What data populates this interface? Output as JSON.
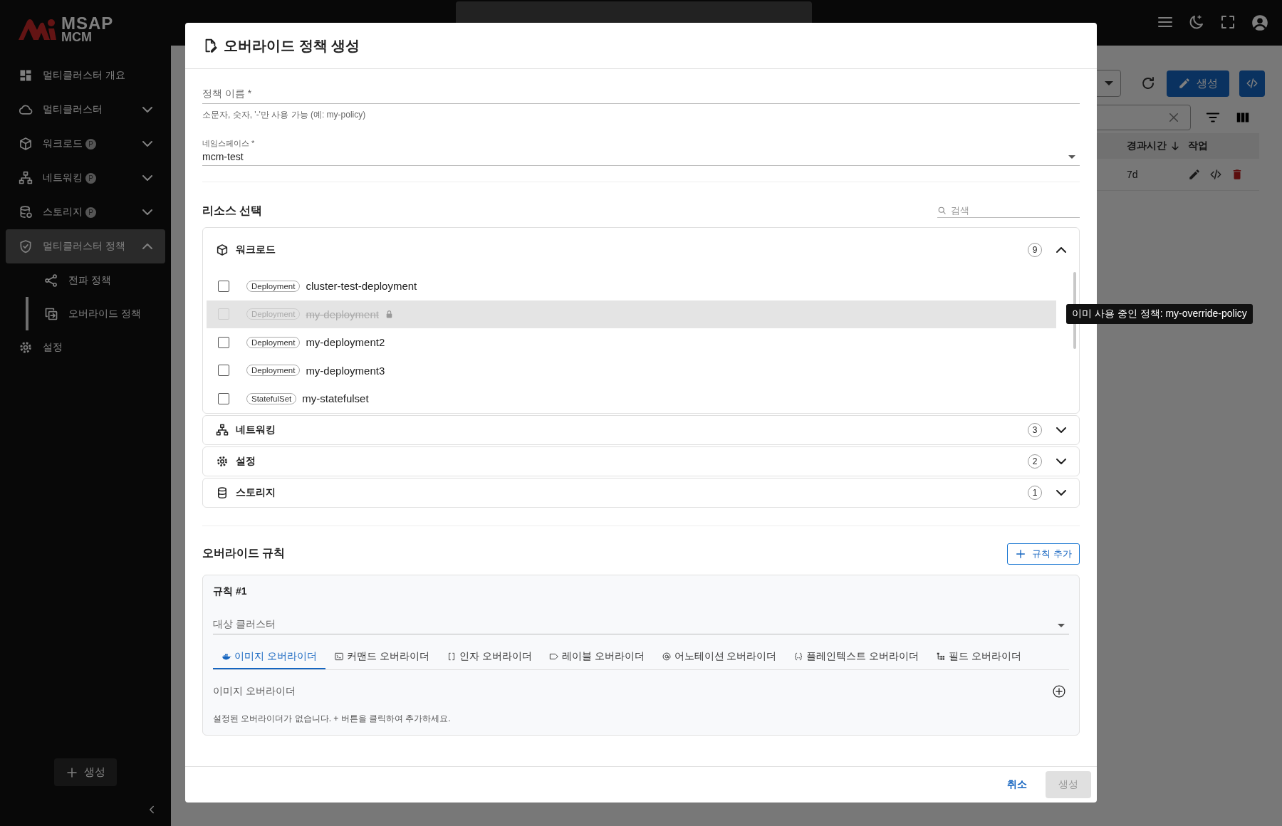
{
  "app": {
    "logo_top": "MSAP",
    "logo_bottom": "MCM"
  },
  "sidebar": {
    "items": [
      {
        "label": "멀티클러스터 개요",
        "selected": false
      },
      {
        "label": "멀티클러스터",
        "selected": false,
        "expanded": false
      },
      {
        "label": "워크로드",
        "badge": "P",
        "selected": false,
        "expanded": false
      },
      {
        "label": "네트워킹",
        "badge": "P",
        "selected": false,
        "expanded": false
      },
      {
        "label": "스토리지",
        "badge": "P",
        "selected": false,
        "expanded": false
      },
      {
        "label": "멀티클러스터 정책",
        "selected": true,
        "expanded": true,
        "children": [
          {
            "label": "전파 정책",
            "selected": false
          },
          {
            "label": "오버라이드 정책",
            "selected": true
          }
        ]
      },
      {
        "label": "설정",
        "selected": false
      }
    ],
    "create_button": "생성"
  },
  "page": {
    "create_button": "생성",
    "table": {
      "columns": [
        {
          "label": "경과시간",
          "sorted": true
        },
        {
          "label": "작업"
        }
      ],
      "rows": [
        {
          "age": "7d"
        }
      ]
    }
  },
  "dialog": {
    "title": "오버라이드 정책 생성",
    "fields": [
      {
        "label": "정책 이름 *",
        "helper": "소문자, 숫자, '-'만 사용 가능 (예: my-policy)"
      },
      {
        "label": "네임스페이스 *",
        "value": "mcm-test",
        "kind": "select"
      }
    ],
    "resources": {
      "title": "리소스 선택",
      "search_placeholder": "검색",
      "groups": [
        {
          "name": "워크로드",
          "count": "9",
          "expanded": true,
          "items": [
            {
              "type": "Deployment",
              "name": "cluster-test-deployment",
              "checked": false,
              "disabled": false,
              "highlighted": false
            },
            {
              "type": "Deployment",
              "name": "my-deployment",
              "checked": false,
              "disabled": true,
              "highlighted": true,
              "tooltip": "이미 사용 중인 정책: my-override-policy"
            },
            {
              "type": "Deployment",
              "name": "my-deployment2",
              "checked": false,
              "disabled": false,
              "highlighted": false
            },
            {
              "type": "Deployment",
              "name": "my-deployment3",
              "checked": false,
              "disabled": false,
              "highlighted": false
            },
            {
              "type": "StatefulSet",
              "name": "my-statefulset",
              "checked": false,
              "disabled": false,
              "highlighted": false
            }
          ]
        },
        {
          "name": "네트워킹",
          "count": "3",
          "expanded": false
        },
        {
          "name": "설정",
          "count": "2",
          "expanded": false
        },
        {
          "name": "스토리지",
          "count": "1",
          "expanded": false
        }
      ]
    },
    "rules_section": {
      "title": "오버라이드 규칙",
      "add_button": "규칙 추가",
      "rules": [
        {
          "title": "규칙 #1",
          "cluster_label": "대상 클러스터",
          "tabs": [
            {
              "label": "이미지 오버라이더",
              "selected": true
            },
            {
              "label": "커맨드 오버라이더",
              "selected": false
            },
            {
              "label": "인자 오버라이더",
              "selected": false
            },
            {
              "label": "레이블 오버라이더",
              "selected": false
            },
            {
              "label": "어노테이션 오버라이더",
              "selected": false
            },
            {
              "label": "플레인텍스트 오버라이더",
              "selected": false
            },
            {
              "label": "필드 오버라이더",
              "selected": false
            }
          ],
          "panel_title": "이미지 오버라이더",
          "empty_text": "설정된 오버라이더가 없습니다. + 버튼을 클릭하여 추가하세요."
        }
      ]
    },
    "footer": {
      "cancel": "취소",
      "submit": {
        "label": "생성",
        "disabled": true
      }
    }
  }
}
